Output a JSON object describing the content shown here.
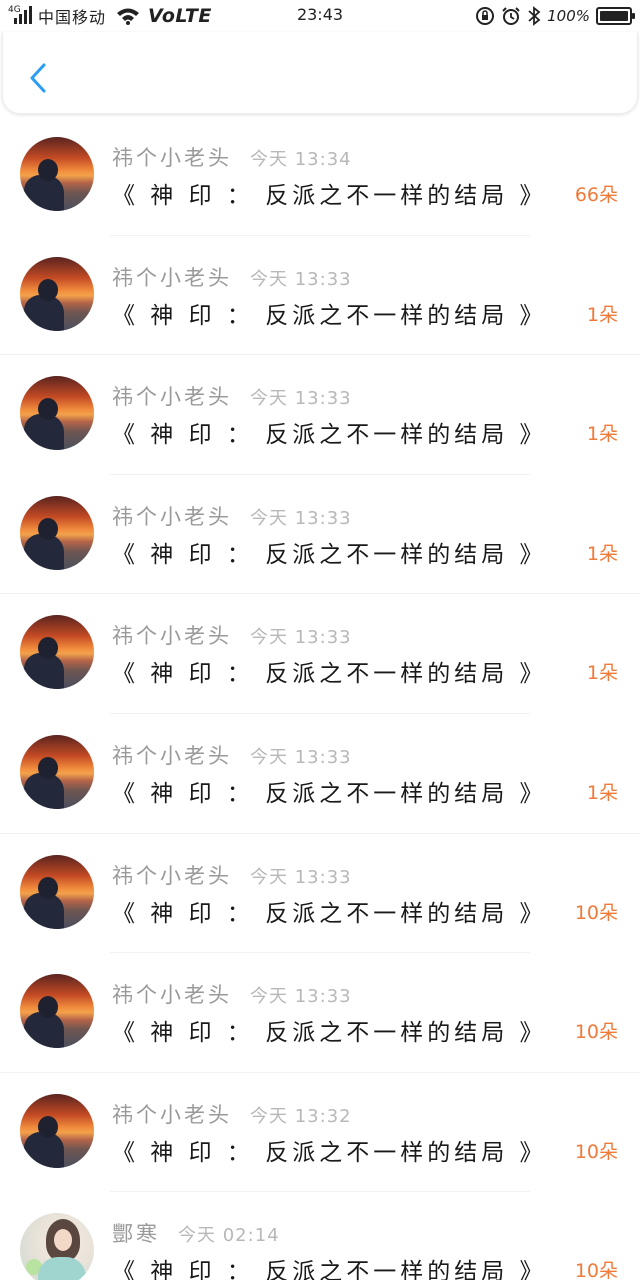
{
  "status_bar": {
    "network": "4G",
    "carrier": "中国移动",
    "volte": "VoLTE",
    "time": "23:43",
    "battery": "100%"
  },
  "header": {
    "back_icon": "chevron-left-icon",
    "accent": "#2a9df4"
  },
  "colors": {
    "amount": "#f07a3a"
  },
  "items": [
    {
      "avatar": "sunset",
      "name": "祎个小老头",
      "time": "今天 13:34",
      "title": "《 神 印 ： 反派之不一样的结局 》",
      "amount": "66朵"
    },
    {
      "avatar": "sunset",
      "name": "祎个小老头",
      "time": "今天 13:33",
      "title": "《 神 印 ： 反派之不一样的结局 》",
      "amount": "1朵"
    },
    {
      "avatar": "sunset",
      "name": "祎个小老头",
      "time": "今天 13:33",
      "title": "《 神 印 ： 反派之不一样的结局 》",
      "amount": "1朵"
    },
    {
      "avatar": "sunset",
      "name": "祎个小老头",
      "time": "今天 13:33",
      "title": "《 神 印 ： 反派之不一样的结局 》",
      "amount": "1朵"
    },
    {
      "avatar": "sunset",
      "name": "祎个小老头",
      "time": "今天 13:33",
      "title": "《 神 印 ： 反派之不一样的结局 》",
      "amount": "1朵"
    },
    {
      "avatar": "sunset",
      "name": "祎个小老头",
      "time": "今天 13:33",
      "title": "《 神 印 ： 反派之不一样的结局 》",
      "amount": "1朵"
    },
    {
      "avatar": "sunset",
      "name": "祎个小老头",
      "time": "今天 13:33",
      "title": "《 神 印 ： 反派之不一样的结局 》",
      "amount": "10朵"
    },
    {
      "avatar": "sunset",
      "name": "祎个小老头",
      "time": "今天 13:33",
      "title": "《 神 印 ： 反派之不一样的结局 》",
      "amount": "10朵"
    },
    {
      "avatar": "sunset",
      "name": "祎个小老头",
      "time": "今天 13:32",
      "title": "《 神 印 ： 反派之不一样的结局 》",
      "amount": "10朵"
    },
    {
      "avatar": "girl",
      "name": "酆寒",
      "time": "今天 02:14",
      "title": "《 神 印 ： 反派之不一样的结局 》",
      "amount": "10朵"
    }
  ]
}
